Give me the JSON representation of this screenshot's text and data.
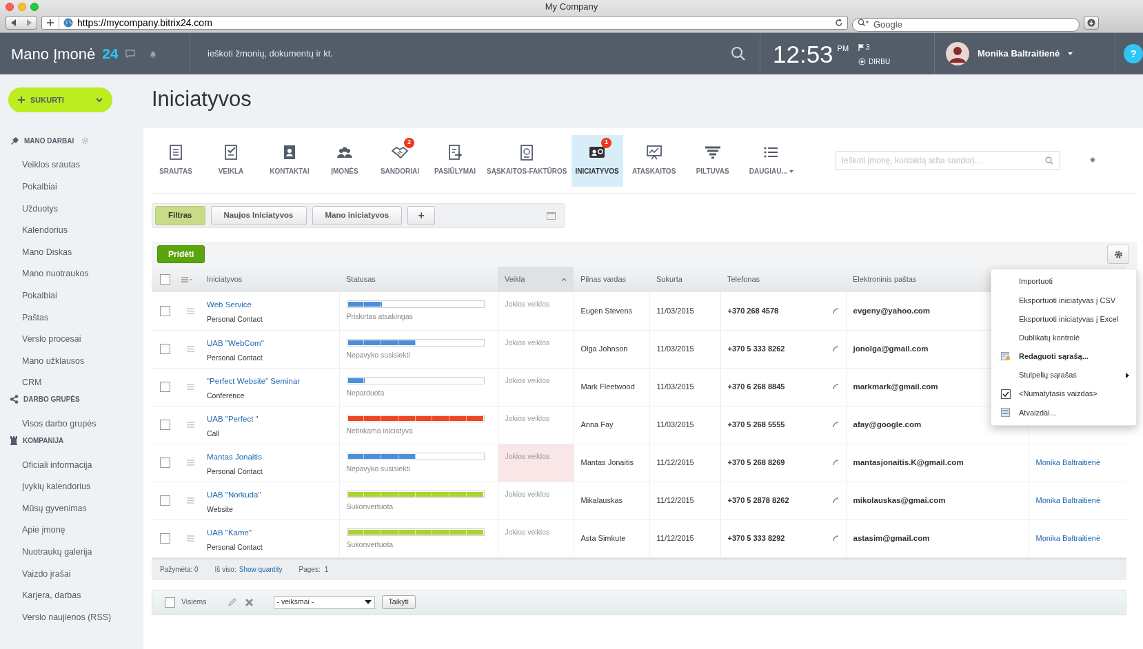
{
  "window": {
    "title": "My Company",
    "url": "https://mycompany.bitrix24.com",
    "search_placeholder": "Google"
  },
  "header": {
    "logo": "Mano Įmonė",
    "logo_number": "24",
    "search_placeholder": "ieškoti žmonių, dokumentų ir kt.",
    "time": "12:53",
    "ampm": "PM",
    "flag_count": "3",
    "work_status": "DIRBU",
    "user": "Monika Baltraitienė",
    "help": "?"
  },
  "sidebar": {
    "create_button": "SUKURTI",
    "sections": [
      {
        "title": "MANO DARBAI",
        "has_settings": true,
        "items": [
          "Veiklos srautas",
          "Pokalbiai",
          "Užduotys",
          "Kalendorius",
          "Mano Diskas",
          "Mano nuotraukos",
          "Pokalbiai",
          "Paštas",
          "Verslo procesai",
          "Mano užklausos",
          "CRM"
        ]
      },
      {
        "title": "DARBO GRUPĖS",
        "has_settings": false,
        "items": [
          "Visos darbo grupės"
        ]
      },
      {
        "title": "KOMPANIJA",
        "has_settings": false,
        "items": [
          "Oficiali informacija",
          "Įvykių kalendorius",
          "Mūsų gyvenimas",
          "Apie įmonę",
          "Nuotraukų galerija",
          "Vaizdo įrašai",
          "Karjera, darbas",
          "Verslo naujienos (RSS)"
        ]
      }
    ]
  },
  "page_title": "Iniciatyvos",
  "crm_tabs": [
    {
      "label": "SRAUTAS",
      "selected": false
    },
    {
      "label": "VEIKLA",
      "selected": false
    },
    {
      "label": "KONTAKTAI",
      "selected": false
    },
    {
      "label": "ĮMONĖS",
      "selected": false
    },
    {
      "label": "SANDORIAI",
      "badge": "2",
      "selected": false
    },
    {
      "label": "PASIŪLYMAI",
      "selected": false
    },
    {
      "label": "SĄSKAITOS-FAKTŪROS",
      "selected": false
    },
    {
      "label": "INICIATYVOS",
      "badge": "1",
      "selected": true
    },
    {
      "label": "ATASKAITOS",
      "selected": false
    },
    {
      "label": "PILTUVAS",
      "selected": false
    },
    {
      "label": "DAUGIAU...",
      "selected": false
    }
  ],
  "crm_search_placeholder": "Ieškoti įmonę, kontaktą arba sandorį...",
  "filter_tabs": [
    {
      "label": "Filtras",
      "selected": true
    },
    {
      "label": "Naujos Iniciatyvos",
      "selected": false
    },
    {
      "label": "Mano iniciatyvos",
      "selected": false
    }
  ],
  "filter_add": "+",
  "add_button": "Pridėti",
  "table": {
    "select_all_checked": false,
    "columns": [
      {
        "label": "Iniciatyvos",
        "sorted": false
      },
      {
        "label": "Statusas",
        "sorted": false
      },
      {
        "label": "Veikla",
        "sorted": true
      },
      {
        "label": "Pilnas vardas",
        "sorted": false
      },
      {
        "label": "Sukurta",
        "sorted": false
      },
      {
        "label": "Telefonas",
        "sorted": false
      },
      {
        "label": "Elektroninis paštas",
        "sorted": false
      }
    ],
    "rows": [
      {
        "checked": false,
        "title": "Web Service",
        "source": "Personal Contact",
        "status": "Priskirtas atsakingas",
        "level": 0.25,
        "color": "#4a90d9",
        "activity": "Jokios veiklos",
        "overdue": false,
        "name": "Eugen Stevens",
        "created": "11/03/2015",
        "phone": "+370 268 4578",
        "email": "evgeny@yahoo.com"
      },
      {
        "checked": false,
        "title": "UAB \"WebCom\"",
        "source": "Personal Contact",
        "status": "Nepavyko susisiekti",
        "level": 0.5,
        "color": "#4a90d9",
        "activity": "Jokios veiklos",
        "overdue": false,
        "name": "Olga Johnson",
        "created": "11/03/2015",
        "phone": "+370 5 333 8262",
        "email": "jonolga@gmail.com"
      },
      {
        "checked": false,
        "title": "\"Perfect Website\" Seminar",
        "source": "Conference",
        "status": "Neparduota",
        "level": 0.125,
        "color": "#4a90d9",
        "activity": "Jokios veiklos",
        "overdue": false,
        "name": "Mark Fleetwood",
        "created": "11/03/2015",
        "phone": "+370 6 268 8845",
        "email": "markmark@gmail.com"
      },
      {
        "checked": false,
        "title": "UAB \"Perfect \"",
        "source": "Call",
        "status": "Netinkama iniciatyva",
        "level": 1,
        "color": "#f0451f",
        "activity": "Jokios veiklos",
        "overdue": false,
        "name": "Anna Fay",
        "created": "11/03/2015",
        "phone": "+370 5 268 5555",
        "email": "afay@google.com"
      },
      {
        "checked": false,
        "title": "Mantas Jonaitis",
        "source": "Personal Contact",
        "status": "Nepavyko susisiekti",
        "level": 0.5,
        "color": "#4a90d9",
        "activity": "Jokios veiklos",
        "overdue": true,
        "name": "Mantas Jonaitis",
        "created": "11/12/2015",
        "phone": "+370 5 268 8269",
        "email": "mantasjonaitis.K@gmail.com",
        "responsible": "Monika Baltraitienė"
      },
      {
        "checked": false,
        "title": "UAB \"Norkuda\"",
        "source": "Website",
        "status": "Sukonvertuota",
        "level": 1,
        "color": "#a8d42c",
        "activity": "Jokios veiklos",
        "overdue": false,
        "name": "Mikalauskas",
        "created": "11/12/2015",
        "phone": "+370 5 2878 8262",
        "email": "mikolauskas@gmai.com",
        "responsible": "Monika Baltraitienė"
      },
      {
        "checked": false,
        "title": "UAB \"Kame\"",
        "source": "Personal Contact",
        "status": "Sukonvertuota",
        "level": 1,
        "color": "#a8d42c",
        "activity": "Jokios veiklos",
        "overdue": false,
        "name": "Asta Simkute",
        "created": "11/12/2015",
        "phone": "+370 5 333 8292",
        "email": "astasim@gmail.com",
        "responsible": "Monika Baltraitienė"
      }
    ]
  },
  "footer": {
    "selected": "Pažymėta: 0",
    "total_label": "Iš viso:",
    "total_link": "Show quantity",
    "pages_label": "Pages:",
    "pages": "1"
  },
  "actions": {
    "all_checked": false,
    "all_label": "Visiems",
    "select": "- veiksmai -",
    "apply": "Taikyti"
  },
  "menu": [
    {
      "kind": "plain",
      "label": "Importuoti"
    },
    {
      "kind": "plain",
      "label": "Eksportuoti iniciatyvas į CSV"
    },
    {
      "kind": "plain",
      "label": "Eksportuoti iniciatyvas į Excel"
    },
    {
      "kind": "plain",
      "label": "Dublikatų kontrolė"
    },
    {
      "kind": "edit",
      "label": "Redaguoti sąrašą..."
    },
    {
      "kind": "submenu",
      "label": "Stulpelių sąrašas"
    },
    {
      "kind": "check",
      "label": "<Numatytasis vaizdas>",
      "checked": true
    },
    {
      "kind": "views",
      "label": "Atvaizdai..."
    }
  ]
}
